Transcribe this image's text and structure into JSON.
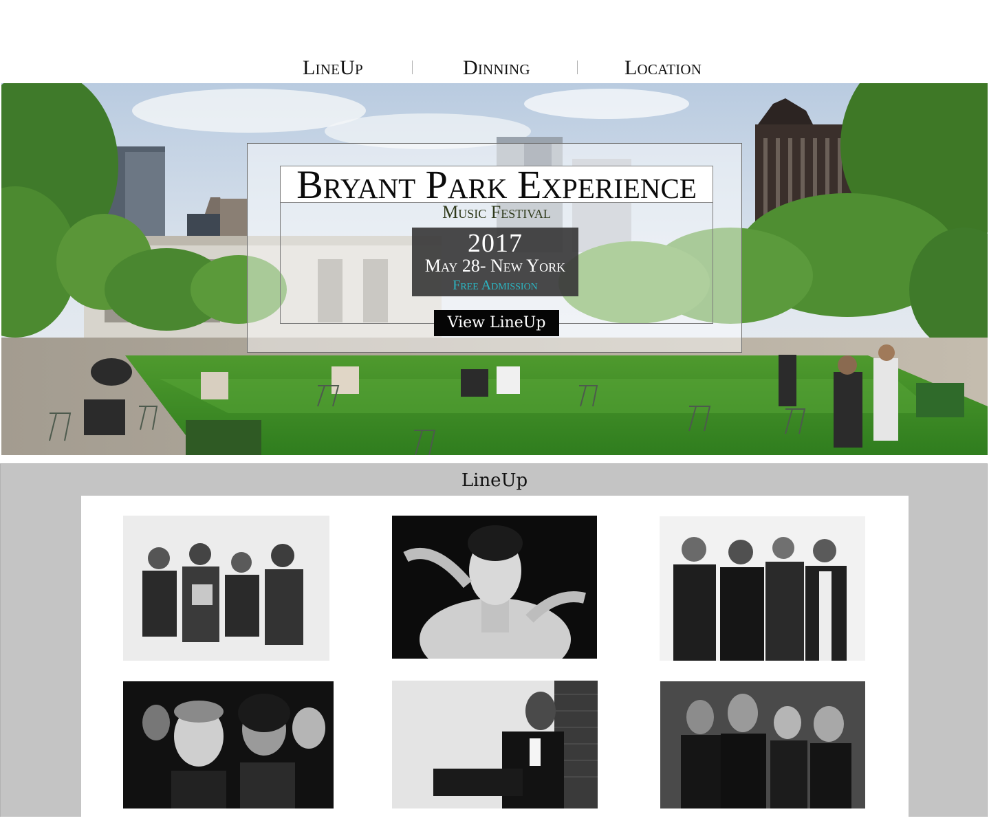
{
  "nav": {
    "items": [
      {
        "label": "LineUp"
      },
      {
        "label": "Dinning"
      },
      {
        "label": "Location"
      }
    ]
  },
  "hero": {
    "title": "Bryant Park Experience",
    "subtitle": "Music Festival",
    "year": "2017",
    "date_location": "May 28- New York",
    "admission": "Free Admission",
    "cta_label": "View LineUp"
  },
  "lineup": {
    "heading": "LineUp",
    "artists": [
      {
        "photo": "band-of-four-photo"
      },
      {
        "photo": "solo-female-portrait-photo"
      },
      {
        "photo": "band-of-four-photo"
      },
      {
        "photo": "band-of-four-photo"
      },
      {
        "photo": "solo-male-portrait-photo"
      },
      {
        "photo": "band-of-four-photo"
      }
    ]
  },
  "colors": {
    "nav_text": "#111111",
    "date_box": "#3a3a3a",
    "admission_text": "#2bb7c4",
    "button_bg": "#050505",
    "section_bg": "#c4c4c4"
  }
}
